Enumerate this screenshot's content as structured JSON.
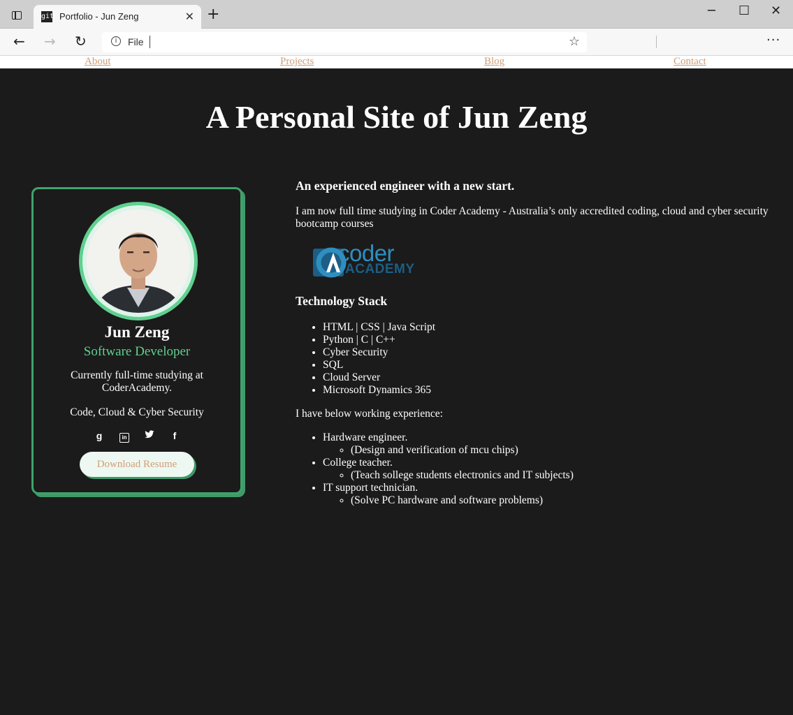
{
  "browser": {
    "tab_title": "Portfolio - Jun Zeng",
    "favicon_text": "git",
    "new_tab": "+",
    "address_scheme": "File",
    "address_url": ""
  },
  "nav": [
    "About",
    "Projects",
    "Blog",
    "Contact"
  ],
  "site_title": "A Personal Site of Jun Zeng",
  "profile": {
    "name": "Jun Zeng",
    "role": "Software Developer",
    "description": "Currently full-time studying at CoderAcademy.",
    "focus": "Code, Cloud & Cyber Security",
    "socials": [
      "google-icon",
      "linkedin-icon",
      "twitter-icon",
      "facebook-icon"
    ],
    "download_label": "Download Resume"
  },
  "intro": {
    "heading": "An experienced engineer with a new start.",
    "paragraph": "I am now full time studying in Coder Academy - Australia’s only accredited coding, cloud and cyber security bootcamp courses"
  },
  "logo": {
    "line1": "coder",
    "line2": "ACADEMY",
    "mark": "A"
  },
  "tech": {
    "heading": "Technology Stack",
    "items": [
      "HTML | CSS | Java Script",
      "Python | C | C++",
      "Cyber Security",
      "SQL",
      "Cloud Server",
      "Microsoft Dynamics 365"
    ]
  },
  "experience": {
    "intro": "I have below working experience:",
    "items": [
      {
        "title": "Hardware engineer.",
        "detail": "(Design and verification of mcu chips)"
      },
      {
        "title": "College teacher.",
        "detail": "(Teach sollege students electronics and IT subjects)"
      },
      {
        "title": "IT support technician.",
        "detail": "(Solve PC hardware and software problems)"
      }
    ]
  },
  "colors": {
    "background": "#1b1b1b",
    "accent_green": "#5fd08f",
    "link": "#cf9e78"
  }
}
